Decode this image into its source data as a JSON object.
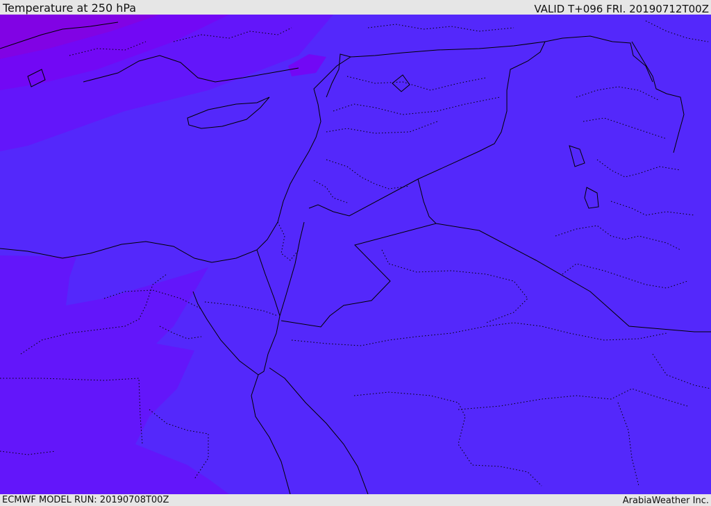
{
  "header": {
    "title": "Temperature at 250 hPa",
    "valid": "VALID T+096 FRI. 20190712T00Z"
  },
  "footer": {
    "model_run": "ECMWF MODEL RUN: 20190708T00Z",
    "credit": "ArabiaWeather Inc."
  },
  "map": {
    "colors": {
      "base": "#5428fb",
      "band_1": "#6316fa",
      "band_2": "#7208f5",
      "band_3": "#8103e4",
      "border": "#000000"
    }
  }
}
